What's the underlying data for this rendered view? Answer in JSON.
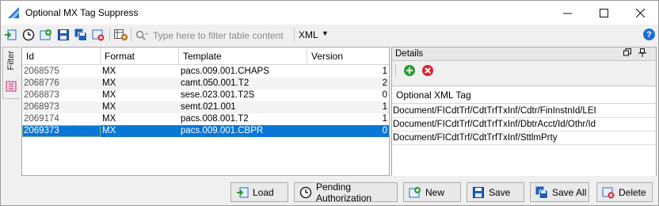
{
  "window": {
    "title": "Optional MX Tag Suppress"
  },
  "toolbar": {
    "filter_placeholder": "Type here to filter table content",
    "format_selected": "XML"
  },
  "side_tab": {
    "label": "Filter"
  },
  "grid": {
    "columns": [
      "Id",
      "Format",
      "Template",
      "Version"
    ],
    "rows": [
      {
        "id": "2068575",
        "format": "MX",
        "template": "pacs.009.001.CHAPS",
        "version": "1"
      },
      {
        "id": "2068776",
        "format": "MX",
        "template": "camt.050.001.T2",
        "version": "2"
      },
      {
        "id": "2068873",
        "format": "MX",
        "template": "sese.023.001.T2S",
        "version": "0"
      },
      {
        "id": "2068973",
        "format": "MX",
        "template": "semt.021.001",
        "version": "1"
      },
      {
        "id": "2069174",
        "format": "MX",
        "template": "pacs.008.001.T2",
        "version": "1"
      },
      {
        "id": "2069373",
        "format": "MX",
        "template": "pacs.009.001.CBPR",
        "version": "0"
      }
    ]
  },
  "details": {
    "title": "Details",
    "column": "Optional XML Tag",
    "rows": [
      "Document/FICdtTrf/CdtTrfTxInf/Cdtr/FinInstnId/LEI",
      "Document/FICdtTrf/CdtTrfTxInf/DbtrAcct/Id/Othr/Id",
      "Document/FICdtTrf/CdtTrfTxInf/SttlmPrty"
    ]
  },
  "buttons": {
    "load": "Load",
    "pending": "Pending Authorization",
    "new": "New",
    "save": "Save",
    "save_all": "Save All",
    "delete": "Delete"
  },
  "colors": {
    "selection": "#0a76d6",
    "accent_green": "#2e9b3a",
    "accent_red": "#d9262b",
    "help_blue": "#1b6fd6"
  }
}
